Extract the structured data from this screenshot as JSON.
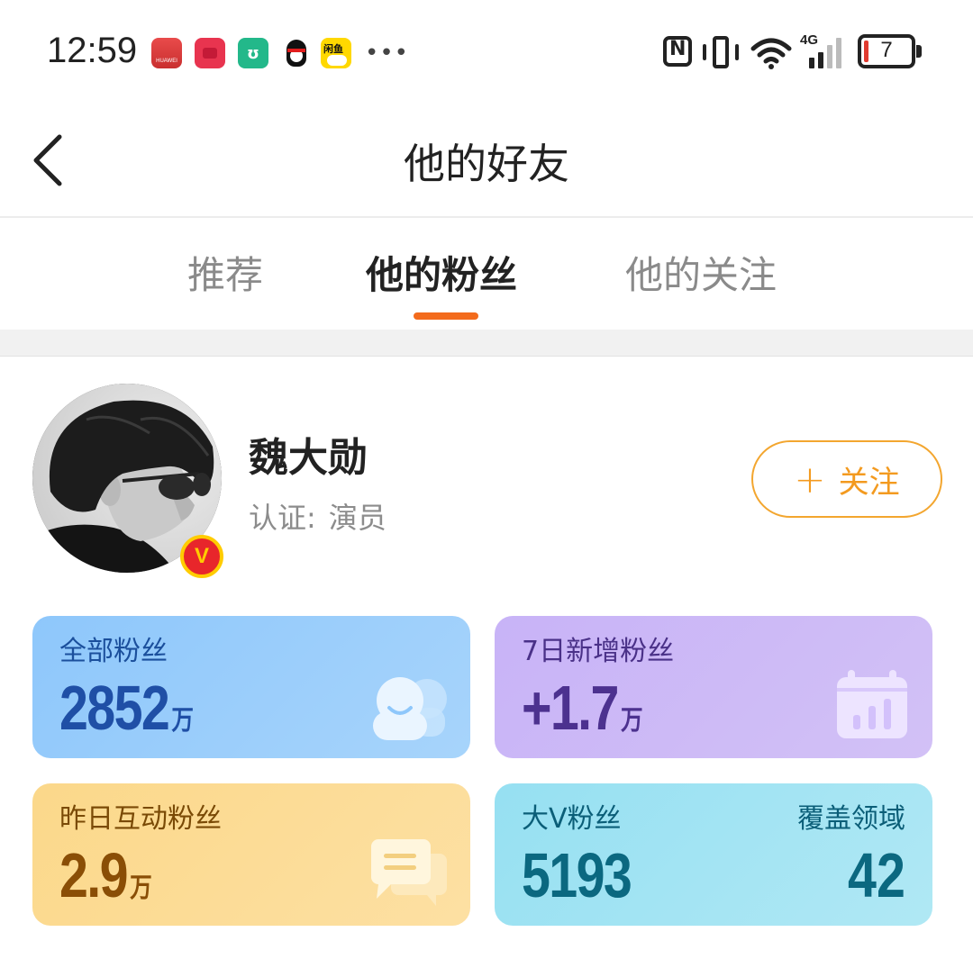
{
  "status_bar": {
    "time": "12:59",
    "notif_huawei_text": "HUAWEI",
    "notif_xianyu_text": "闲鱼",
    "battery_level": "7",
    "network": "4G",
    "notification_icons": [
      "huawei-appgallery-icon",
      "red-app-icon",
      "mi-home-icon",
      "qq-icon",
      "xianyu-icon",
      "more-dots-icon"
    ]
  },
  "nav": {
    "title": "他的好友"
  },
  "tabs": [
    {
      "label": "推荐",
      "active": false
    },
    {
      "label": "他的粉丝",
      "active": true
    },
    {
      "label": "他的关注",
      "active": false
    }
  ],
  "profile": {
    "name": "魏大勋",
    "cert_label": "认证:",
    "cert_value": "演员",
    "verified_mark": "V",
    "follow_plus": "+",
    "follow_label": "关注"
  },
  "stats": {
    "total_fans": {
      "label": "全部粉丝",
      "value": "2852",
      "unit": "万"
    },
    "new_fans_7d": {
      "label": "7日新增粉丝",
      "value": "+1.7",
      "unit": "万"
    },
    "interactive_fans": {
      "label": "昨日互动粉丝",
      "value": "2.9",
      "unit": "万"
    },
    "bigv_fans": {
      "label": "大V粉丝",
      "value": "5193",
      "label2": "覆盖领域",
      "value2": "42"
    }
  },
  "colors": {
    "accent": "#f36b1c",
    "follow_orange": "#f39a1f",
    "card_blue": "#8ec7fb",
    "card_purple": "#c8b3f7",
    "card_yellow": "#fbd88a",
    "card_cyan": "#96e0f2"
  }
}
